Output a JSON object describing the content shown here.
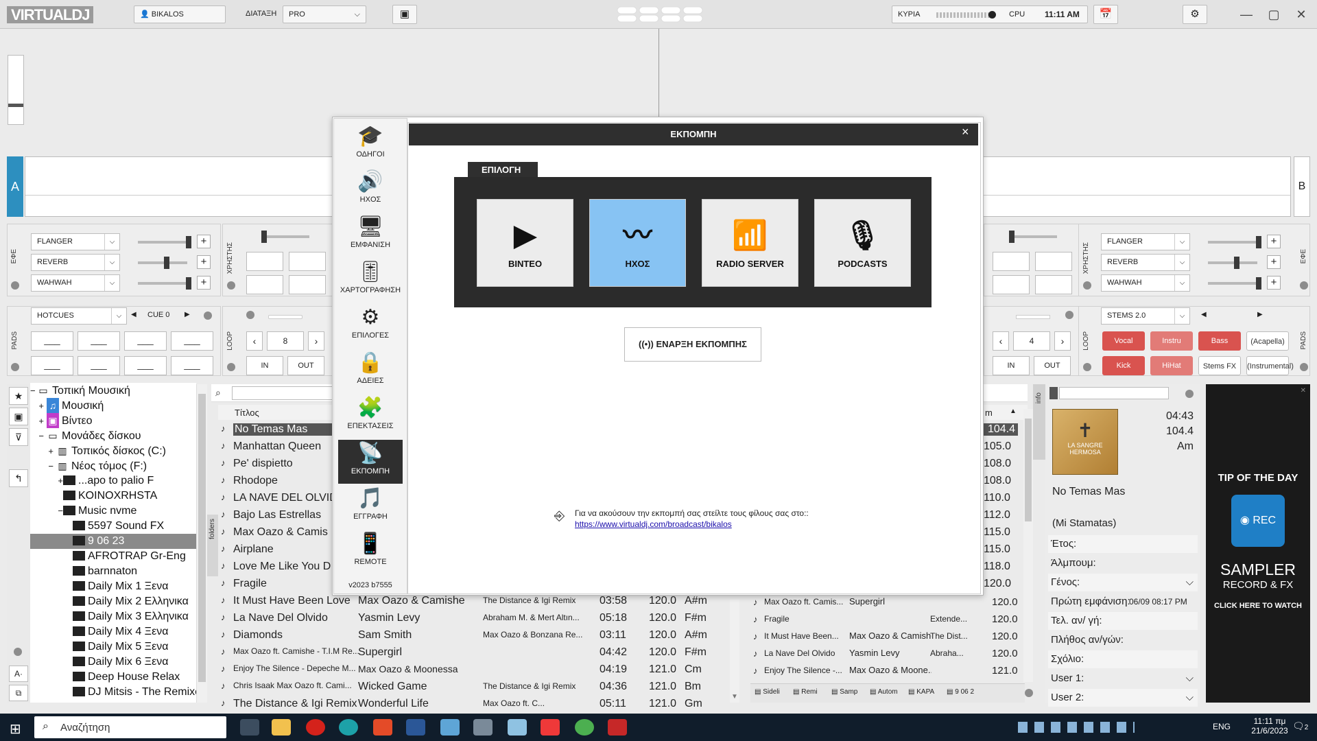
{
  "app": {
    "logo": "VIRTUALDJ",
    "user": "BIKALOS",
    "layout_label": "ΔΙΑΤΑΞΗ",
    "layout_value": "PRO",
    "master_label": "ΚΥΡΙΑ",
    "cpu_label": "CPU",
    "clock": "11:11 AM"
  },
  "decks": {
    "a_label": "A",
    "b_label": "B"
  },
  "fx_left": [
    "FLANGER",
    "REVERB",
    "WAHWAH"
  ],
  "fx_right": [
    "FLANGER",
    "REVERB",
    "WAHWAH"
  ],
  "labels": {
    "efe": "ΕΦΕ",
    "user": "ΧΡΗΣΤΗΣ",
    "pads": "PADS",
    "loop": "LOOP",
    "folders": "folders",
    "info": "info"
  },
  "pads_left": {
    "mode": "HOTCUES",
    "cue": "CUE 0",
    "loop_size": "8",
    "in": "IN",
    "out": "OUT",
    "pad_value": "___"
  },
  "pads_right": {
    "mode": "STEMS 2.0",
    "loop_size": "4",
    "in": "IN",
    "out": "OUT",
    "stems": [
      {
        "label": "Vocal",
        "color": "#d9534f"
      },
      {
        "label": "Instru",
        "color": "#e27b77"
      },
      {
        "label": "Bass",
        "color": "#d9534f"
      },
      {
        "label": "(Acapella)",
        "color": "#ffffff"
      },
      {
        "label": "Kick",
        "color": "#d9534f"
      },
      {
        "label": "HiHat",
        "color": "#e27b77"
      },
      {
        "label": "Stems FX",
        "color": "#ffffff"
      },
      {
        "label": "(Instrumental)",
        "color": "#ffffff"
      }
    ]
  },
  "tree": [
    {
      "label": "Τοπική Μουσική",
      "exp": "−",
      "indent": 0,
      "icon": "monitor"
    },
    {
      "label": "Μουσική",
      "exp": "+",
      "indent": 1,
      "icon": "music"
    },
    {
      "label": "Βίντεο",
      "exp": "+",
      "indent": 1,
      "icon": "video"
    },
    {
      "label": "Μονάδες δίσκου",
      "exp": "−",
      "indent": 1,
      "icon": "monitor"
    },
    {
      "label": "Τοπικός δίσκος (C:)",
      "exp": "+",
      "indent": 2,
      "icon": "drive"
    },
    {
      "label": "Νέος τόμος (F:)",
      "exp": "−",
      "indent": 2,
      "icon": "drive"
    },
    {
      "label": "...apo to palio F",
      "exp": "+",
      "indent": 3,
      "icon": "folder"
    },
    {
      "label": "KOINOXRHSTA",
      "exp": "",
      "indent": 3,
      "icon": "folder"
    },
    {
      "label": "Music nvme",
      "exp": "−",
      "indent": 3,
      "icon": "folder"
    },
    {
      "label": "5597 Sound FX",
      "exp": "",
      "indent": 4,
      "icon": "folder"
    },
    {
      "label": "9 06 23",
      "exp": "",
      "indent": 4,
      "icon": "folder",
      "selected": true
    },
    {
      "label": "AFROTRAP Gr-Eng",
      "exp": "",
      "indent": 4,
      "icon": "folder"
    },
    {
      "label": "barnnaton",
      "exp": "",
      "indent": 4,
      "icon": "folder"
    },
    {
      "label": "Daily Mix 1 Ξενα",
      "exp": "",
      "indent": 4,
      "icon": "folder"
    },
    {
      "label": "Daily Mix 2 Ελληνικα",
      "exp": "",
      "indent": 4,
      "icon": "folder"
    },
    {
      "label": "Daily Mix 3 Ελληνικα",
      "exp": "",
      "indent": 4,
      "icon": "folder"
    },
    {
      "label": "Daily Mix 4 Ξενα",
      "exp": "",
      "indent": 4,
      "icon": "folder"
    },
    {
      "label": "Daily Mix 5 Ξενα",
      "exp": "",
      "indent": 4,
      "icon": "folder"
    },
    {
      "label": "Daily Mix 6 Ξενα",
      "exp": "",
      "indent": 4,
      "icon": "folder"
    },
    {
      "label": "Deep House Relax",
      "exp": "",
      "indent": 4,
      "icon": "folder"
    },
    {
      "label": "DJ Mitsis - The Remixes",
      "exp": "",
      "indent": 4,
      "icon": "folder"
    }
  ],
  "browser": {
    "col_title": "Τίτλος",
    "col_bpm": "m",
    "rows": [
      {
        "title": "No Temas Mas",
        "artist": "",
        "remix": "",
        "len": "",
        "bpm": "104.4",
        "key": "",
        "selected": true
      },
      {
        "title": "Manhattan Queen",
        "artist": "",
        "remix": "",
        "len": "",
        "bpm": "105.0",
        "key": ""
      },
      {
        "title": "Pe' dispietto",
        "artist": "",
        "remix": "",
        "len": "",
        "bpm": "108.0",
        "key": ""
      },
      {
        "title": "Rhodope",
        "artist": "",
        "remix": "",
        "len": "",
        "bpm": "108.0",
        "key": ""
      },
      {
        "title": "LA NAVE DEL OLVIDO ( rem",
        "artist": "",
        "remix": "",
        "len": "",
        "bpm": "110.0",
        "key": ""
      },
      {
        "title": "Bajo Las Estrellas",
        "artist": "",
        "remix": "",
        "len": "",
        "bpm": "112.0",
        "key": ""
      },
      {
        "title": "Max Oazo & Camis",
        "artist": "",
        "remix": "",
        "len": "",
        "bpm": "115.0",
        "key": ""
      },
      {
        "title": "Airplane",
        "artist": "",
        "remix": "",
        "len": "",
        "bpm": "115.0",
        "key": ""
      },
      {
        "title": "Love Me Like You D",
        "artist": "",
        "remix": "",
        "len": "",
        "bpm": "118.0",
        "key": ""
      },
      {
        "title": "Fragile",
        "artist": "",
        "remix": "",
        "len": "",
        "bpm": "120.0",
        "key": ""
      },
      {
        "title": "It Must Have Been Love",
        "artist": "Max Oazo & Camishe",
        "remix": "The Distance & Igi Remix",
        "len": "03:58",
        "bpm": "120.0",
        "key": "A#m"
      },
      {
        "title": "La Nave Del Olvido",
        "artist": "Yasmin Levy",
        "remix": "Abraham M. & Mert Altın...",
        "len": "05:18",
        "bpm": "120.0",
        "key": "F#m"
      },
      {
        "title": "Diamonds",
        "artist": "Sam Smith",
        "remix": "Max Oazo & Bonzana Re...",
        "len": "03:11",
        "bpm": "120.0",
        "key": "A#m"
      },
      {
        "title": "Max Oazo ft. Camishe - T.I.M Re...",
        "artist": "Supergirl",
        "remix": "",
        "len": "04:42",
        "bpm": "120.0",
        "key": "F#m"
      },
      {
        "title": "Enjoy The Silence - Depeche M...",
        "artist": "Max Oazo & Moonessa",
        "remix": "",
        "len": "04:19",
        "bpm": "121.0",
        "key": "Cm"
      },
      {
        "title": "Chris Isaak    Max Oazo ft. Cami...",
        "artist": "Wicked Game",
        "remix": "The Distance & Igi Remix",
        "len": "04:36",
        "bpm": "121.0",
        "key": "Bm"
      },
      {
        "title": "The Distance & Igi Remix",
        "artist": "Wonderful Life",
        "remix": "Max Oazo ft. C...",
        "len": "05:11",
        "bpm": "121.0",
        "key": "Gm"
      }
    ]
  },
  "sidelist": [
    {
      "title": "Max Oazo ft. Camis...",
      "artist": "Supergirl",
      "remix": "",
      "bpm": "120.0"
    },
    {
      "title": "Fragile",
      "artist": "",
      "remix": "Extende...",
      "bpm": "120.0"
    },
    {
      "title": "It Must Have Been...",
      "artist": "Max Oazo & Camishe",
      "remix": "The Dist...",
      "bpm": "120.0"
    },
    {
      "title": "La Nave Del Olvido",
      "artist": "Yasmin Levy",
      "remix": "Abraha...",
      "bpm": "120.0"
    },
    {
      "title": "Enjoy The Silence -...",
      "artist": "Max Oazo & Moone...",
      "remix": "",
      "bpm": "121.0"
    }
  ],
  "bottom_tabs": [
    "Sideli",
    "Remi",
    "Samp",
    "Autom",
    "ΚΑΡΑ",
    "9 06 2"
  ],
  "trackinfo": {
    "length": "04:43",
    "bpm": "104.4",
    "key": "Am",
    "album_art_text": "LA SANGRE HERMOSA",
    "title": "No Temas Mas",
    "artist": "(Mi  Stamatas)",
    "fields": [
      {
        "label": "Έτος:",
        "value": ""
      },
      {
        "label": "Άλμπουμ:",
        "value": ""
      },
      {
        "label": "Γένος:",
        "value": ""
      },
      {
        "label": "Πρώτη εμφάνιση:",
        "value": "06/09 08:17 PM"
      },
      {
        "label": "Τελ. αν/ γή:",
        "value": ""
      },
      {
        "label": "Πλήθος αν/γών:",
        "value": ""
      },
      {
        "label": "Σχόλιο:",
        "value": ""
      },
      {
        "label": "User 1:",
        "value": ""
      },
      {
        "label": "User 2:",
        "value": ""
      }
    ]
  },
  "tip": {
    "heading": "TIP OF THE DAY",
    "badge": "REC",
    "line1": "SAMPLER",
    "line2": "RECORD & FX",
    "cta": "CLICK HERE TO WATCH"
  },
  "settings_nav": [
    {
      "label": "ΟΔΗΓΟΙ",
      "icon": "graduation-cap-icon",
      "glyph": "🎓"
    },
    {
      "label": "ΗΧΟΣ",
      "icon": "speaker-icon",
      "glyph": "🔊"
    },
    {
      "label": "ΕΜΦΑΝΙΣΗ",
      "icon": "monitor-icon",
      "glyph": "🖥"
    },
    {
      "label": "ΧΑΡΤΟΓΡΑΦΗΣΗ",
      "icon": "sliders-icon",
      "glyph": "🎚"
    },
    {
      "label": "ΕΠΙΛΟΓΕΣ",
      "icon": "gear-icon",
      "glyph": "⚙"
    },
    {
      "label": "ΑΔΕΙΕΣ",
      "icon": "lock-icon",
      "glyph": "🔒"
    },
    {
      "label": "ΕΠΕΚΤΑΣΕΙΣ",
      "icon": "puzzle-icon",
      "glyph": "🧩"
    },
    {
      "label": "ΕΚΠΟΜΠΗ",
      "icon": "satellite-dish-icon",
      "glyph": "📡",
      "active": true
    },
    {
      "label": "ΕΓΓΡΑΦΗ",
      "icon": "music-note-icon",
      "glyph": "🎵"
    },
    {
      "label": "REMOTE",
      "icon": "phone-icon",
      "glyph": "📱"
    }
  ],
  "version": "v2023 b7555",
  "dialog": {
    "title": "ΕΚΠΟΜΠΗ",
    "close": "×",
    "section": "ΕΠΙΛΟΓΗ",
    "options": [
      {
        "label": "ΒΙΝΤΕΟ",
        "icon": "play-screen-icon",
        "glyph": "▶",
        "selected": false
      },
      {
        "label": "ΗΧΟΣ",
        "icon": "waveform-icon",
        "glyph": "〰",
        "selected": true
      },
      {
        "label": "RADIO SERVER",
        "icon": "antenna-icon",
        "glyph": "📶",
        "selected": false
      },
      {
        "label": "PODCASTS",
        "icon": "podcast-icon",
        "glyph": "🎙",
        "selected": false
      }
    ],
    "start_button": "ΕΝΑΡΞΗ ΕΚΠΟΜΠΗΣ",
    "share_text": "Για να ακούσουν την εκπομπή σας στείλτε τους φίλους σας στο::",
    "share_link": "https://www.virtualdj.com/broadcast/bikalos"
  },
  "taskbar": {
    "search_placeholder": "Αναζήτηση",
    "lang": "ENG",
    "time": "11:11 πμ",
    "date": "21/6/2023",
    "notif": "2"
  },
  "colors": {
    "accent": "#87c3f3",
    "deck_a": "#2d8fbf",
    "stem_red": "#d9534f",
    "taskbar": "#101d2b"
  }
}
